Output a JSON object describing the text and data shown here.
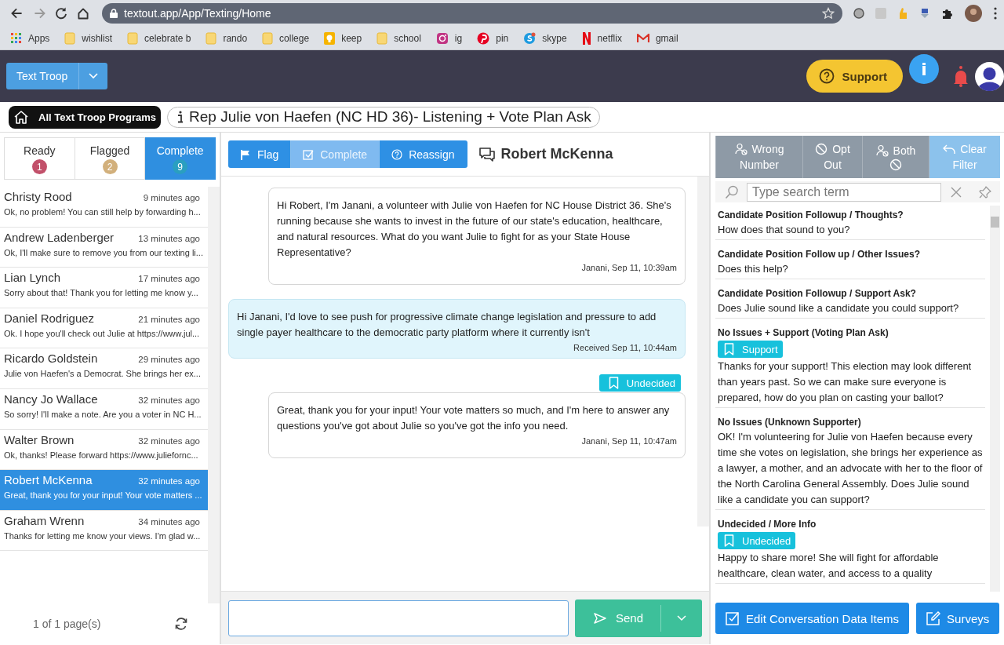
{
  "browser": {
    "url": "textout.app/App/Texting/Home",
    "bookmarks": [
      {
        "label": "Apps",
        "kind": "apps"
      },
      {
        "label": "wishlist",
        "kind": "folder"
      },
      {
        "label": "celebrate b",
        "kind": "folder"
      },
      {
        "label": "rando",
        "kind": "folder"
      },
      {
        "label": "college",
        "kind": "folder"
      },
      {
        "label": "keep",
        "kind": "keep"
      },
      {
        "label": "school",
        "kind": "folder"
      },
      {
        "label": "ig",
        "kind": "instagram"
      },
      {
        "label": "pin",
        "kind": "pinterest"
      },
      {
        "label": "skype",
        "kind": "skype"
      },
      {
        "label": "netflix",
        "kind": "netflix"
      },
      {
        "label": "gmail",
        "kind": "mail"
      }
    ]
  },
  "header": {
    "program_menu": "Text Troop",
    "support": "Support",
    "info": "i"
  },
  "program_bar": {
    "home": "All Text Troop Programs",
    "campaign": "Rep Julie von Haefen (NC HD 36)- Listening + Vote Plan Ask"
  },
  "status_tabs": [
    {
      "label": "Ready",
      "count": "1",
      "color": "#c2506a",
      "selected": false
    },
    {
      "label": "Flagged",
      "count": "2",
      "color": "#d2b07c",
      "selected": false
    },
    {
      "label": "Complete",
      "count": "9",
      "color": "#2a9fc0",
      "selected": true
    }
  ],
  "conversations": [
    {
      "name": "Christy Rood",
      "time": "9 minutes ago",
      "preview": "Ok, no problem! You can still help by forwarding h...",
      "selected": false
    },
    {
      "name": "Andrew Ladenberger",
      "time": "13 minutes ago",
      "preview": "Ok, I'll make sure to remove you from our texting li...",
      "selected": false
    },
    {
      "name": "Lian Lynch",
      "time": "17 minutes ago",
      "preview": "Sorry about that! Thank you for letting me know y...",
      "selected": false
    },
    {
      "name": "Daniel Rodriguez",
      "time": "21 minutes ago",
      "preview": "Ok. I hope you'll check out Julie at https://www.jul...",
      "selected": false
    },
    {
      "name": "Ricardo Goldstein",
      "time": "29 minutes ago",
      "preview": "Julie von Haefen's a Democrat. She brings her ex...",
      "selected": false
    },
    {
      "name": "Nancy Jo Wallace",
      "time": "32 minutes ago",
      "preview": "So sorry! I'll make a note. Are you a voter in NC H...",
      "selected": false
    },
    {
      "name": "Walter Brown",
      "time": "32 minutes ago",
      "preview": "Ok, thanks! Please forward https://www.juliefornc...",
      "selected": false
    },
    {
      "name": "Robert McKenna",
      "time": "32 minutes ago",
      "preview": "Great, thank you for your input! Your vote matters ...",
      "selected": true
    },
    {
      "name": "Graham Wrenn",
      "time": "34 minutes ago",
      "preview": "Thanks for letting me know your views. I'm glad w...",
      "selected": false
    }
  ],
  "pagination": "1 of 1 page(s)",
  "chat": {
    "actions": [
      {
        "label": "Flag",
        "kind": "flag",
        "disabled": false
      },
      {
        "label": "Complete",
        "kind": "complete",
        "disabled": true
      },
      {
        "label": "Reassign",
        "kind": "reassign",
        "disabled": false
      }
    ],
    "contact": "Robert McKenna",
    "messages": [
      {
        "kind": "sent",
        "text": "Hi Robert, I'm Janani, a volunteer with Julie von Haefen for NC House District 36. She's running because she wants to invest in the future of our state's education, healthcare, and natural resources. What do you want Julie to fight for as your State House Representative?",
        "meta": "Janani, Sep 11, 10:39am"
      },
      {
        "kind": "received",
        "text": "Hi Janani, I'd love to see push for progressive climate change legislation and pressure to add single payer healthcare to the democratic party platform where it currently isn't",
        "meta": "Received Sep 11, 10:44am"
      },
      {
        "kind": "sent",
        "tag": "Undecided",
        "text": "Great, thank you for your input! Your vote matters so much, and I'm here to answer any questions you've got about Julie so you've got the info you need.",
        "meta": "Janani, Sep 11, 10:47am"
      }
    ]
  },
  "composer": {
    "send": "Send"
  },
  "filters": [
    {
      "label": "Wrong Number",
      "kind": "wrong-number",
      "selected": false
    },
    {
      "label": "Opt Out",
      "kind": "opt-out",
      "selected": false
    },
    {
      "label": "Both",
      "kind": "both",
      "selected": false
    },
    {
      "label": "Clear Filter",
      "kind": "clear",
      "selected": true
    }
  ],
  "search": {
    "placeholder": "Type search term"
  },
  "scripts": [
    {
      "title": "Candidate Position Followup / Thoughts?",
      "text": "How does that sound to you?"
    },
    {
      "title": "Candidate Position Follow up / Other Issues?",
      "text": "Does this help?"
    },
    {
      "title": "Candidate Position Followup / Support Ask?",
      "text": "Does Julie sound like a candidate you could support?"
    },
    {
      "title": "No Issues + Support (Voting Plan Ask)",
      "tag": "Support",
      "text": "Thanks for your support! This election may look different than years past. So we can make sure everyone is prepared, how do you plan on casting your ballot?"
    },
    {
      "title": "No Issues (Unknown Supporter)",
      "text": "OK! I'm volunteering for Julie von Haefen because every time she votes on legislation, she brings her experience as a lawyer, a mother, and an advocate with her to the floor of the North Carolina General Assembly. Does Julie sound like a candidate you can support?"
    },
    {
      "title": "Undecided / More Info",
      "tag": "Undecided",
      "text": "Happy to share more! She will fight for affordable healthcare, clean water, and access to a quality"
    }
  ],
  "footer_buttons": [
    {
      "label": "Edit Conversation Data Items",
      "kind": "edit-data"
    },
    {
      "label": "Surveys",
      "kind": "surveys"
    }
  ]
}
